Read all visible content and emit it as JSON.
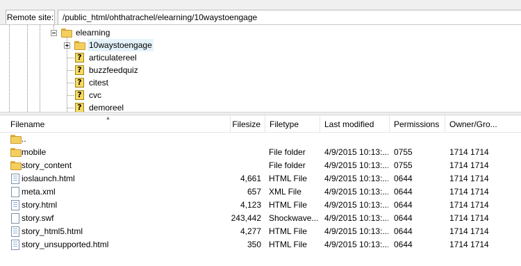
{
  "site_bar": {
    "label": "Remote site:",
    "path": "/public_html/ohthatrachel/elearning/10waystoengage"
  },
  "tree": {
    "parent": {
      "label": "elearning",
      "icon": "folder-icon",
      "expander": "minus"
    },
    "children": [
      {
        "label": "10waystoengage",
        "icon": "folder-icon",
        "expander": "plus",
        "selected": true
      },
      {
        "label": "articulatereel",
        "icon": "unknown-folder-icon"
      },
      {
        "label": "buzzfeedquiz",
        "icon": "unknown-folder-icon"
      },
      {
        "label": "citest",
        "icon": "unknown-folder-icon"
      },
      {
        "label": "cvc",
        "icon": "unknown-folder-icon"
      },
      {
        "label": "demoreel",
        "icon": "unknown-folder-icon"
      }
    ]
  },
  "list": {
    "columns": {
      "filename": "Filename",
      "filesize": "Filesize",
      "filetype": "Filetype",
      "last_modified": "Last modified",
      "permissions": "Permissions",
      "owner_group": "Owner/Gro..."
    },
    "rows": [
      {
        "icon": "folder-icon",
        "name": "..",
        "size": "",
        "type": "",
        "modified": "",
        "perms": "",
        "owner": ""
      },
      {
        "icon": "folder-icon",
        "name": "mobile",
        "size": "",
        "type": "File folder",
        "modified": "4/9/2015 10:13:...",
        "perms": "0755",
        "owner": "1714 1714"
      },
      {
        "icon": "folder-icon",
        "name": "story_content",
        "size": "",
        "type": "File folder",
        "modified": "4/9/2015 10:13:...",
        "perms": "0755",
        "owner": "1714 1714"
      },
      {
        "icon": "html-file-icon",
        "name": "ioslaunch.html",
        "size": "4,661",
        "type": "HTML File",
        "modified": "4/9/2015 10:13:...",
        "perms": "0644",
        "owner": "1714 1714"
      },
      {
        "icon": "blank-file-icon",
        "name": "meta.xml",
        "size": "657",
        "type": "XML File",
        "modified": "4/9/2015 10:13:...",
        "perms": "0644",
        "owner": "1714 1714"
      },
      {
        "icon": "html-file-icon",
        "name": "story.html",
        "size": "4,123",
        "type": "HTML File",
        "modified": "4/9/2015 10:13:...",
        "perms": "0644",
        "owner": "1714 1714"
      },
      {
        "icon": "blank-file-icon",
        "name": "story.swf",
        "size": "243,442",
        "type": "Shockwave...",
        "modified": "4/9/2015 10:13:...",
        "perms": "0644",
        "owner": "1714 1714"
      },
      {
        "icon": "html-file-icon",
        "name": "story_html5.html",
        "size": "4,277",
        "type": "HTML File",
        "modified": "4/9/2015 10:13:...",
        "perms": "0644",
        "owner": "1714 1714"
      },
      {
        "icon": "html-file-icon",
        "name": "story_unsupported.html",
        "size": "350",
        "type": "HTML File",
        "modified": "4/9/2015 10:13:...",
        "perms": "0644",
        "owner": "1714 1714"
      }
    ]
  },
  "colors": {
    "folder": "#f3cf5e",
    "selection": "#e5f3fb",
    "chrome": "#f0f0f0"
  }
}
